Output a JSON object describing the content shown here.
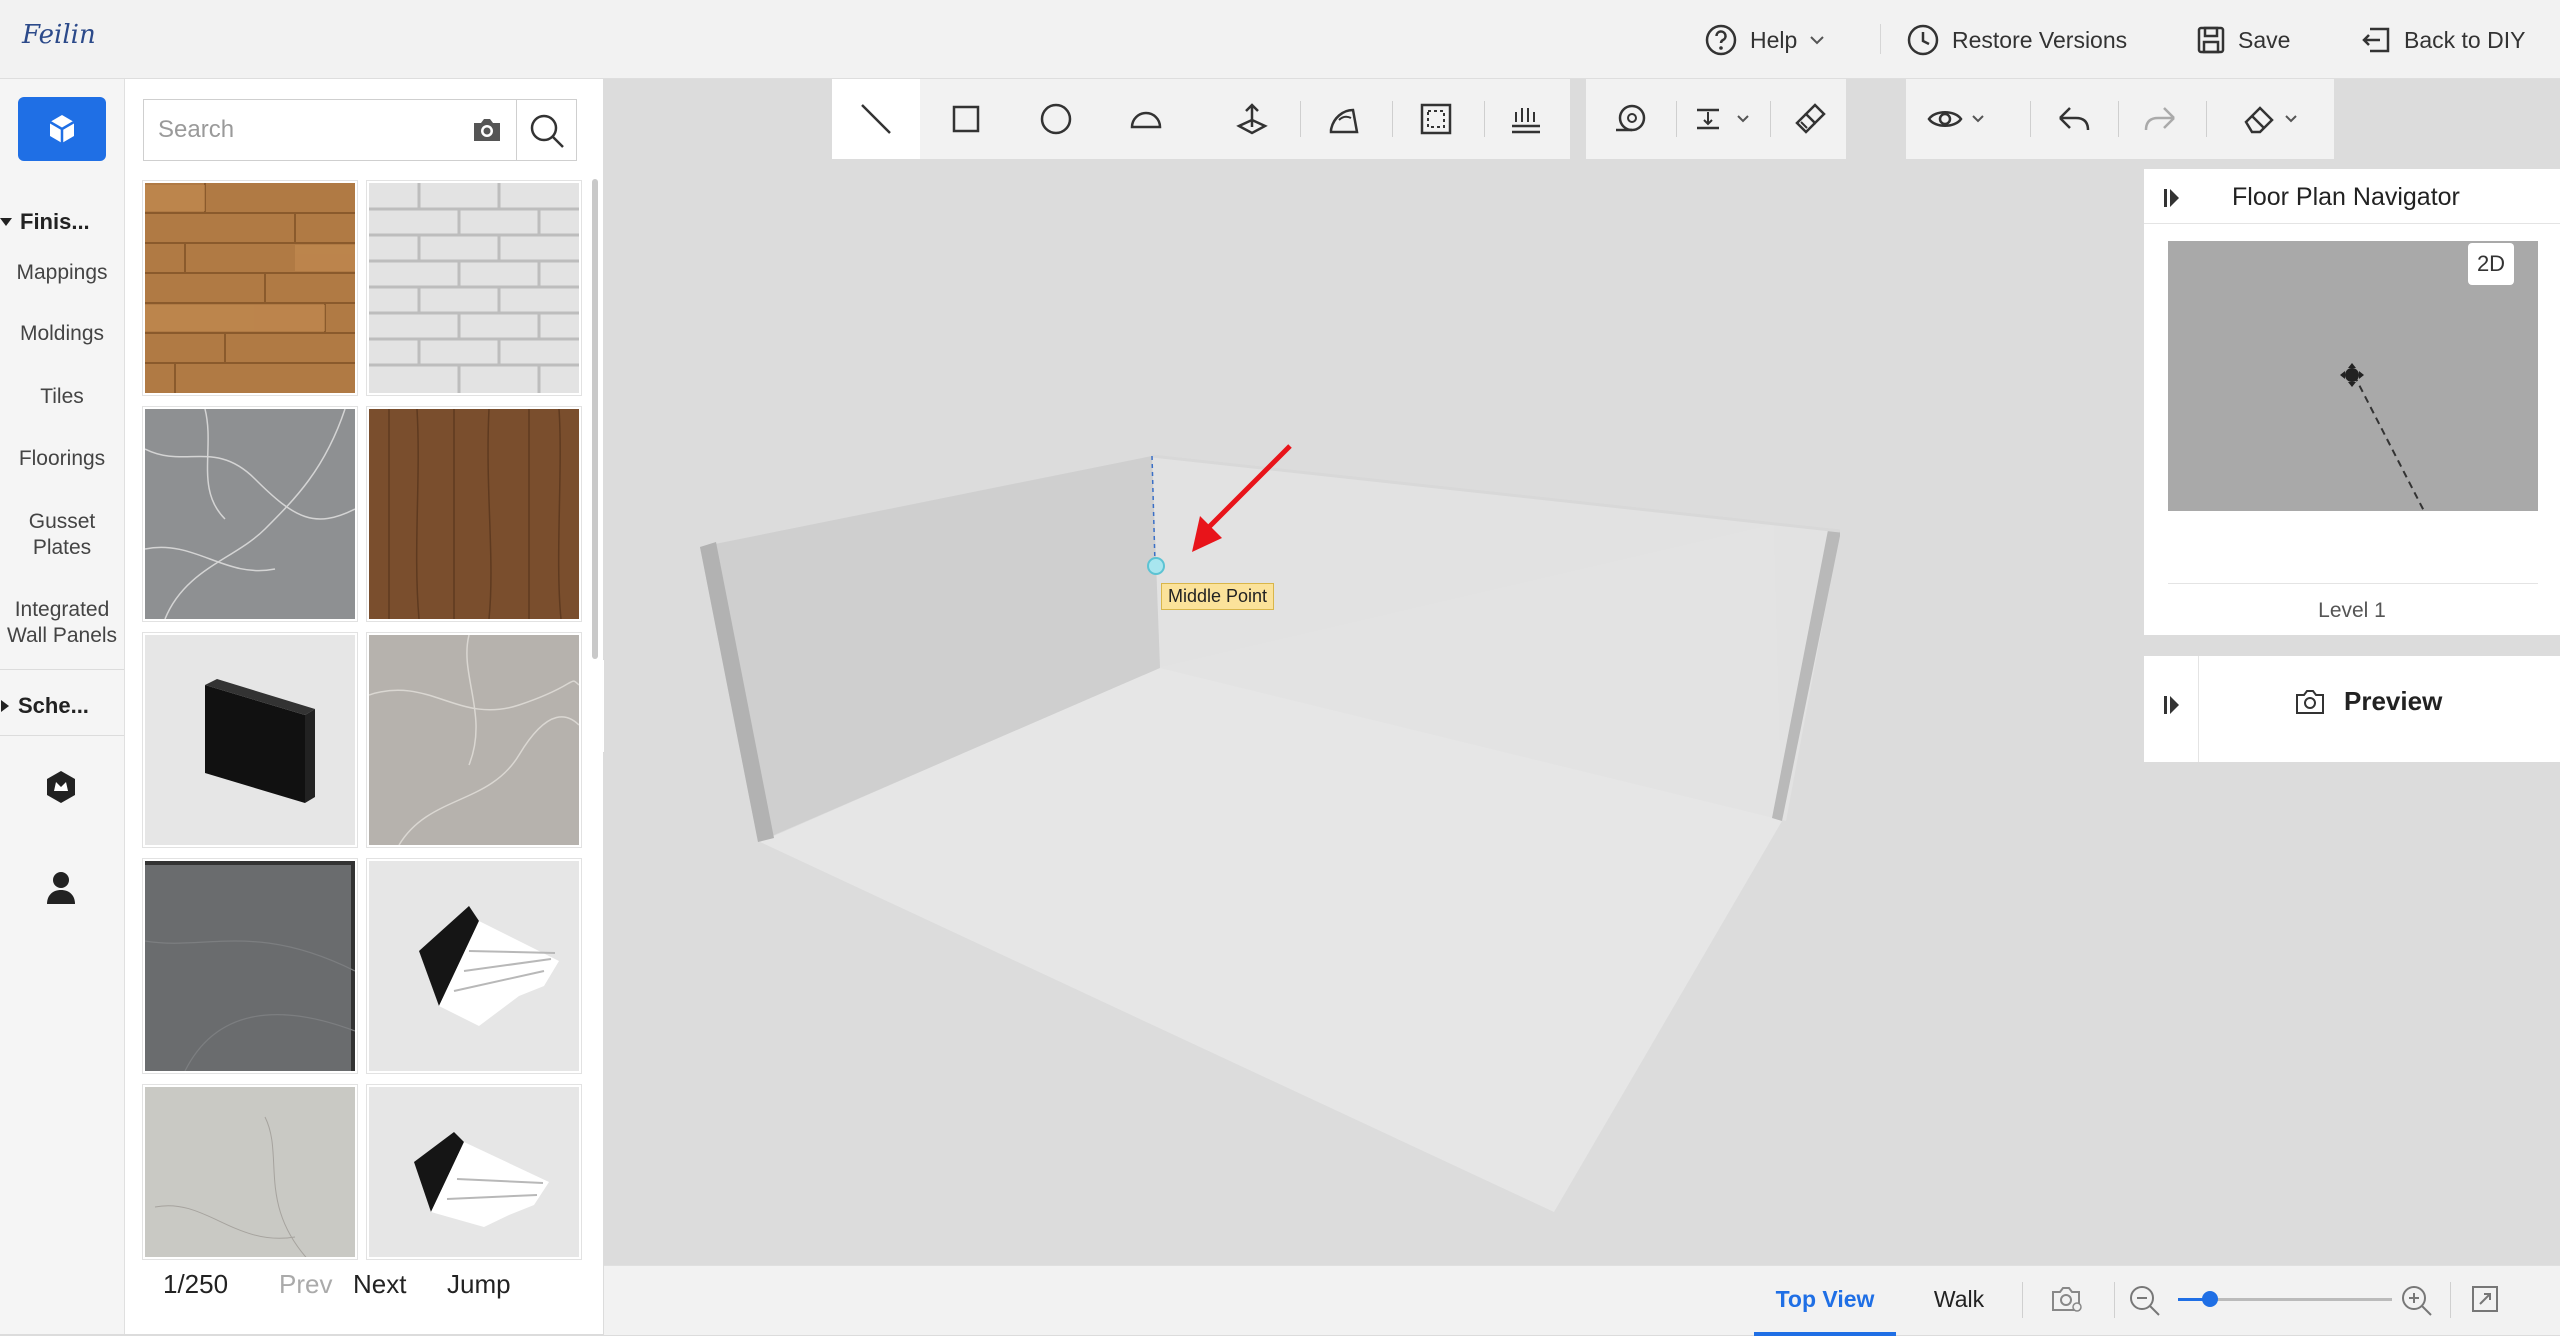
{
  "header": {
    "logo_text": "Feilin",
    "help_label": "Help",
    "restore_label": "Restore Versions",
    "save_label": "Save",
    "back_label": "Back to DIY"
  },
  "rail": {
    "groups": [
      "Finis...",
      "Sche..."
    ],
    "items": [
      "Mappings",
      "Moldings",
      "Tiles",
      "Floorings",
      "Gusset Plates",
      "Integrated Wall Panels"
    ]
  },
  "catalog": {
    "search_placeholder": "Search",
    "pager": {
      "page": "1/250",
      "prev": "Prev",
      "next": "Next",
      "jump": "Jump"
    }
  },
  "viewport": {
    "snap_label": "Middle Point"
  },
  "navigator": {
    "title": "Floor Plan Navigator",
    "mode_label": "2D",
    "level_label": "Level 1"
  },
  "preview": {
    "label": "Preview"
  },
  "bottombar": {
    "top_view_label": "Top View",
    "walk_label": "Walk",
    "zoom_level": 0.15
  },
  "colors": {
    "accent": "#1f6fe5",
    "snap_label_bg": "#fbe29a",
    "arrow": "#e8141a"
  }
}
